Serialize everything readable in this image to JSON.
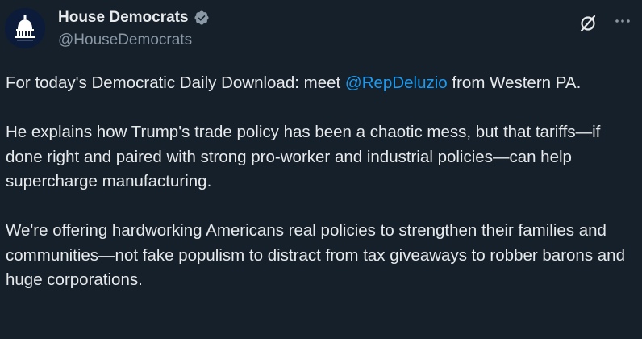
{
  "author": {
    "display_name": "House Democrats",
    "handle": "@HouseDemocrats",
    "verified": true
  },
  "tweet": {
    "p1_before": "For today's Democratic Daily Download: meet ",
    "p1_mention": "@RepDeluzio",
    "p1_after": " from Western PA.",
    "p2": "He explains how Trump's trade policy has been a chaotic mess, but that tariffs—if done right and paired with strong pro-worker and industrial policies—can help supercharge manufacturing.",
    "p3": "We're offering hardworking Americans real policies to strengthen their families and communities—not fake populism to distract from tax giveaways to robber barons and huge corporations."
  },
  "icons": {
    "avatar": "capitol-dome-icon",
    "verified": "verified-badge-icon",
    "grok": "grok-icon",
    "more": "more-options-icon"
  },
  "colors": {
    "background": "#15202b",
    "text": "#e7e9ea",
    "secondary": "#8b98a5",
    "accent": "#1d9bf0"
  }
}
